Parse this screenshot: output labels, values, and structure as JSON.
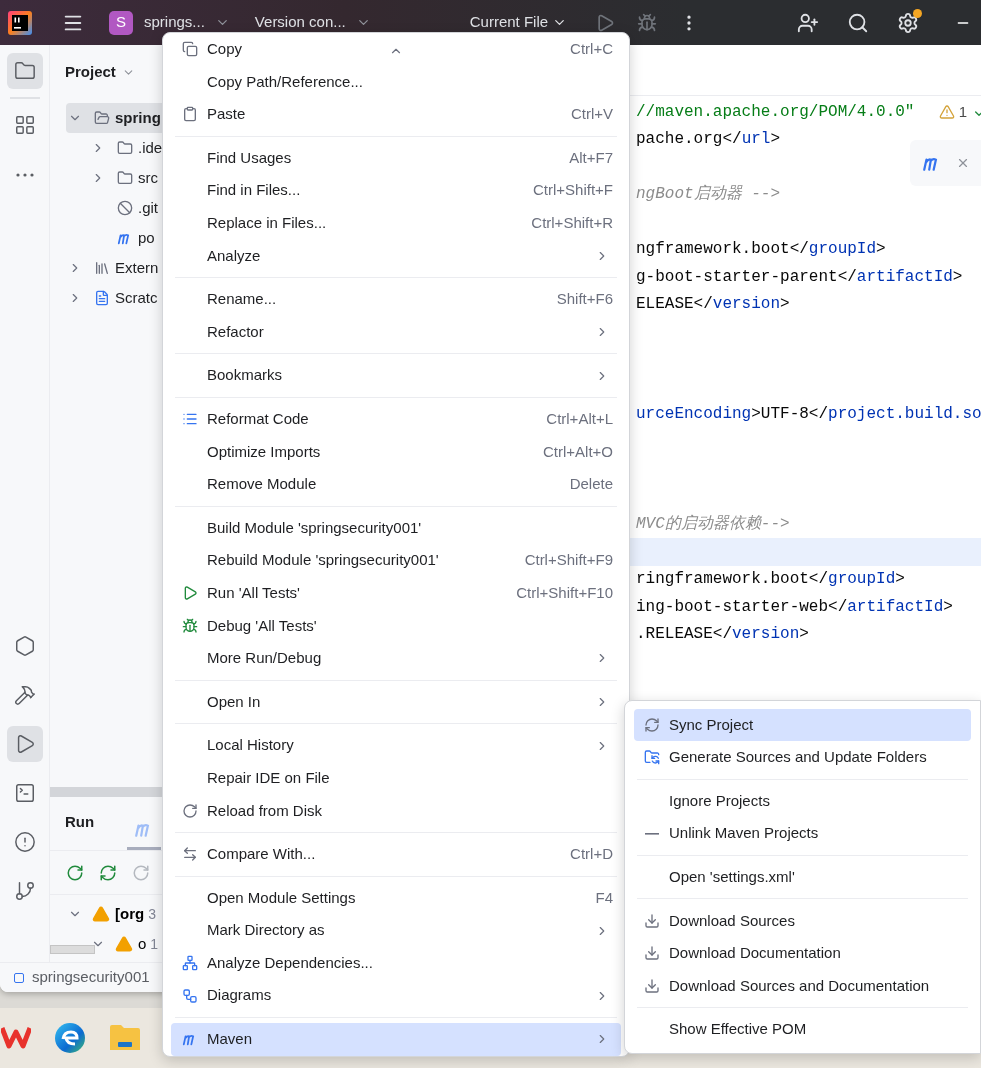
{
  "top_bar": {
    "project_badge": "S",
    "project_name": "springs...",
    "vcs": "Version con...",
    "run_config": "Current File",
    "run_enabled": false,
    "debug_enabled": false,
    "settings_notification": true
  },
  "tool_strip": {
    "top": [
      {
        "selected": true
      },
      {
        "selected": false
      },
      {
        "selected": false
      }
    ],
    "bottom": [
      {
        "selected": false
      },
      {
        "selected": false
      },
      {
        "selected": true
      },
      {
        "selected": false
      },
      {
        "selected": false
      },
      {
        "selected": false
      }
    ]
  },
  "project_panel": {
    "title": "Project",
    "tree": [
      {
        "label": "spring",
        "kind": "module",
        "expanded": true,
        "selected": true,
        "children": [
          {
            "label": ".ide",
            "kind": "folder",
            "expanded": false,
            "selected": false
          },
          {
            "label": "src",
            "kind": "folder",
            "expanded": false,
            "selected": false
          },
          {
            "label": ".git",
            "kind": "ignored_file",
            "selected": false
          },
          {
            "label": "po",
            "kind": "build_file",
            "selected": false
          }
        ]
      },
      {
        "label": "Extern",
        "kind": "libraries",
        "expanded": false,
        "selected": false
      },
      {
        "label": "Scratc",
        "kind": "scratches",
        "expanded": false,
        "selected": false
      }
    ]
  },
  "run_panel": {
    "title": "Run",
    "tabs": [
      {
        "selected": true
      }
    ],
    "problems": [
      {
        "label": "[org",
        "count": "3",
        "expanded": true,
        "children": [
          {
            "label": "o",
            "count": "1",
            "expanded": true
          }
        ]
      }
    ]
  },
  "status_bar": {
    "module": "springsecurity001"
  },
  "editor": {
    "inspection_count": "1",
    "lines": [
      {
        "current": false,
        "segments": [
          {
            "kind": "string",
            "text": "//maven.apache.org/POM/4.0.0\""
          }
        ]
      },
      {
        "current": false,
        "segments": [
          {
            "kind": "text",
            "text": "pache.org</"
          },
          {
            "kind": "tag",
            "text": "url"
          },
          {
            "kind": "text",
            "text": ">"
          }
        ]
      },
      {
        "current": false
      },
      {
        "current": false,
        "segments": [
          {
            "kind": "comment",
            "text": "ngBoot启动器 -->"
          }
        ]
      },
      {
        "current": false
      },
      {
        "current": false,
        "segments": [
          {
            "kind": "text",
            "text": "ngframework.boot</"
          },
          {
            "kind": "tag",
            "text": "groupId"
          },
          {
            "kind": "text",
            "text": ">"
          }
        ]
      },
      {
        "current": false,
        "segments": [
          {
            "kind": "text",
            "text": "g-boot-starter-parent</"
          },
          {
            "kind": "tag",
            "text": "artifactId"
          },
          {
            "kind": "text",
            "text": ">"
          }
        ]
      },
      {
        "current": false,
        "segments": [
          {
            "kind": "text",
            "text": "ELEASE</"
          },
          {
            "kind": "tag",
            "text": "version"
          },
          {
            "kind": "text",
            "text": ">"
          }
        ]
      },
      {
        "current": false
      },
      {
        "current": false
      },
      {
        "current": false
      },
      {
        "current": false,
        "segments": [
          {
            "kind": "tag",
            "text": "urceEncoding"
          },
          {
            "kind": "text",
            "text": ">UTF-8</"
          },
          {
            "kind": "tag",
            "text": "project.build.so"
          }
        ]
      },
      {
        "current": false
      },
      {
        "current": false
      },
      {
        "current": false
      },
      {
        "current": false,
        "segments": [
          {
            "kind": "comment",
            "text": "MVC的启动器依赖-->"
          }
        ]
      },
      {
        "current": true
      },
      {
        "current": false,
        "segments": [
          {
            "kind": "text",
            "text": "ringframework.boot</"
          },
          {
            "kind": "tag",
            "text": "groupId"
          },
          {
            "kind": "text",
            "text": ">"
          }
        ]
      },
      {
        "current": false,
        "segments": [
          {
            "kind": "text",
            "text": "ing-boot-starter-web</"
          },
          {
            "kind": "tag",
            "text": "artifactId"
          },
          {
            "kind": "text",
            "text": ">"
          }
        ]
      },
      {
        "current": false,
        "segments": [
          {
            "kind": "text",
            "text": ".RELEASE</"
          },
          {
            "kind": "tag",
            "text": "version"
          },
          {
            "kind": "text",
            "text": ">"
          }
        ]
      }
    ]
  },
  "context_menu": {
    "groups": [
      [
        {
          "label": "Copy",
          "shortcut": "Ctrl+C",
          "submenu": false,
          "selected": false
        },
        {
          "label": "Copy Path/Reference...",
          "submenu": false,
          "selected": false
        },
        {
          "label": "Paste",
          "shortcut": "Ctrl+V",
          "submenu": false,
          "selected": false
        }
      ],
      [
        {
          "label": "Find Usages",
          "shortcut": "Alt+F7",
          "submenu": false,
          "selected": false
        },
        {
          "label": "Find in Files...",
          "shortcut": "Ctrl+Shift+F",
          "submenu": false,
          "selected": false
        },
        {
          "label": "Replace in Files...",
          "shortcut": "Ctrl+Shift+R",
          "submenu": false,
          "selected": false
        },
        {
          "label": "Analyze",
          "submenu": true,
          "selected": false
        }
      ],
      [
        {
          "label": "Rename...",
          "shortcut": "Shift+F6",
          "submenu": false,
          "selected": false
        },
        {
          "label": "Refactor",
          "submenu": true,
          "selected": false
        }
      ],
      [
        {
          "label": "Bookmarks",
          "submenu": true,
          "selected": false
        }
      ],
      [
        {
          "label": "Reformat Code",
          "shortcut": "Ctrl+Alt+L",
          "submenu": false,
          "selected": false
        },
        {
          "label": "Optimize Imports",
          "shortcut": "Ctrl+Alt+O",
          "submenu": false,
          "selected": false
        },
        {
          "label": "Remove Module",
          "shortcut": "Delete",
          "submenu": false,
          "selected": false
        }
      ],
      [
        {
          "label": "Build Module 'springsecurity001'",
          "submenu": false,
          "selected": false
        },
        {
          "label": "Rebuild Module 'springsecurity001'",
          "shortcut": "Ctrl+Shift+F9",
          "submenu": false,
          "selected": false
        },
        {
          "label": "Run 'All Tests'",
          "shortcut": "Ctrl+Shift+F10",
          "submenu": false,
          "selected": false
        },
        {
          "label": "Debug 'All Tests'",
          "submenu": false,
          "selected": false
        },
        {
          "label": "More Run/Debug",
          "submenu": true,
          "selected": false
        }
      ],
      [
        {
          "label": "Open In",
          "submenu": true,
          "selected": false
        }
      ],
      [
        {
          "label": "Local History",
          "submenu": true,
          "selected": false
        },
        {
          "label": "Repair IDE on File",
          "submenu": false,
          "selected": false
        },
        {
          "label": "Reload from Disk",
          "submenu": false,
          "selected": false
        }
      ],
      [
        {
          "label": "Compare With...",
          "shortcut": "Ctrl+D",
          "submenu": false,
          "selected": false
        }
      ],
      [
        {
          "label": "Open Module Settings",
          "shortcut": "F4",
          "submenu": false,
          "selected": false
        },
        {
          "label": "Mark Directory as",
          "submenu": true,
          "selected": false
        },
        {
          "label": "Analyze Dependencies...",
          "submenu": false,
          "selected": false
        },
        {
          "label": "Diagrams",
          "submenu": true,
          "selected": false
        }
      ],
      [
        {
          "label": "Maven",
          "submenu": true,
          "selected": true
        }
      ]
    ]
  },
  "maven_submenu": {
    "groups": [
      [
        {
          "label": "Sync Project",
          "selected": true
        },
        {
          "label": "Generate Sources and Update Folders",
          "selected": false
        }
      ],
      [
        {
          "label": "Ignore Projects",
          "selected": false
        },
        {
          "label": "Unlink Maven Projects",
          "selected": false
        }
      ],
      [
        {
          "label": "Open 'settings.xml'",
          "selected": false
        }
      ],
      [
        {
          "label": "Download Sources",
          "selected": false
        },
        {
          "label": "Download Documentation",
          "selected": false
        },
        {
          "label": "Download Sources and Documentation",
          "selected": false
        }
      ],
      [
        {
          "label": "Show Effective POM",
          "selected": false
        }
      ]
    ]
  }
}
